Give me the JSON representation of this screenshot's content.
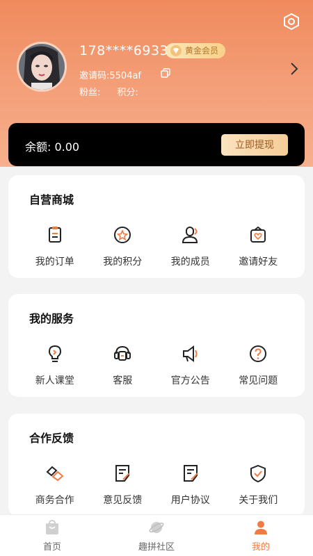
{
  "header": {
    "phone": "178****6933",
    "member_badge": "黄金会员",
    "invite_code": "邀请码:5504af",
    "fans_label": "粉丝:",
    "points_label": "积分:"
  },
  "balance": {
    "text": "余额: 0.00",
    "withdraw_label": "立即提现"
  },
  "sections": [
    {
      "title": "自营商城",
      "items": [
        {
          "label": "我的订单",
          "icon": "order-icon"
        },
        {
          "label": "我的积分",
          "icon": "points-icon"
        },
        {
          "label": "我的成员",
          "icon": "members-icon"
        },
        {
          "label": "邀请好友",
          "icon": "invite-friends-icon"
        }
      ]
    },
    {
      "title": "我的服务",
      "items": [
        {
          "label": "新人课堂",
          "icon": "lightbulb-icon"
        },
        {
          "label": "客服",
          "icon": "customer-service-icon"
        },
        {
          "label": "官方公告",
          "icon": "megaphone-icon"
        },
        {
          "label": "常见问题",
          "icon": "question-icon"
        }
      ]
    },
    {
      "title": "合作反馈",
      "items": [
        {
          "label": "商务合作",
          "icon": "handshake-icon"
        },
        {
          "label": "意见反馈",
          "icon": "feedback-icon"
        },
        {
          "label": "用户协议",
          "icon": "agreement-icon"
        },
        {
          "label": "关于我们",
          "icon": "shield-check-icon"
        }
      ]
    }
  ],
  "tabs": [
    {
      "label": "首页",
      "icon": "home-bag-icon"
    },
    {
      "label": "趣拼社区",
      "icon": "community-planet-icon"
    },
    {
      "label": "我的",
      "icon": "profile-icon",
      "active": true
    }
  ],
  "colors": {
    "accent": "#f07b45",
    "hero_top": "#f08a5d",
    "gold": "#f5cd97"
  }
}
